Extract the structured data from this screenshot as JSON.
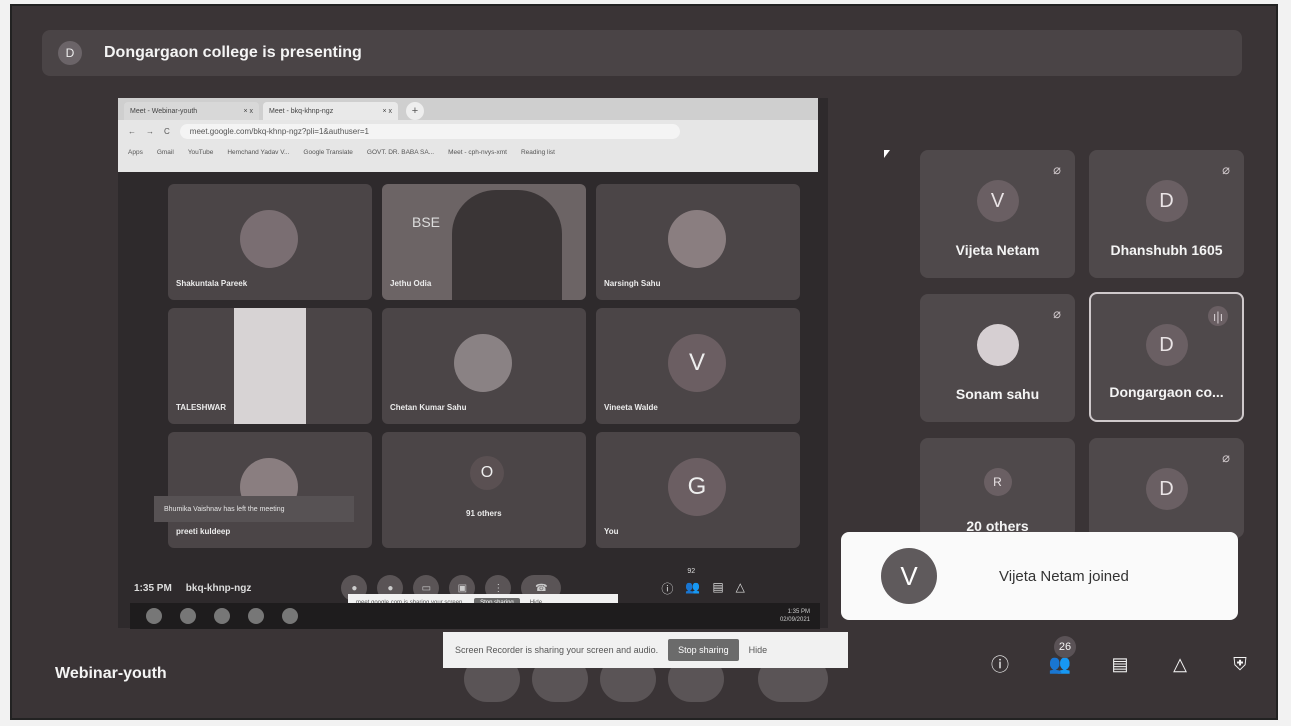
{
  "presenting": {
    "avatar_letter": "D",
    "text": "Dongargaon college is presenting"
  },
  "browser": {
    "tabs": [
      {
        "label": "Meet - Webinar-youth",
        "close": "× x"
      },
      {
        "label": "Meet - bkq-khnp-ngz",
        "close": "× x"
      }
    ],
    "new_tab": "+",
    "url": "meet.google.com/bkq-khnp-ngz?pli=1&authuser=1",
    "bookmarks": [
      "Apps",
      "Gmail",
      "YouTube",
      "Hemchand Yadav V...",
      "Google Translate",
      "GOVT. DR. BABA SA...",
      "Meet - cph-nvys-xmt",
      "Reading list"
    ]
  },
  "shared_meeting": {
    "tiles": [
      {
        "name": "Shakuntala Pareek",
        "type": "photo"
      },
      {
        "name": "Jethu Odia",
        "type": "video",
        "video_text": "BSE"
      },
      {
        "name": "Narsingh Sahu",
        "type": "photo"
      },
      {
        "name": "TALESHWAR",
        "type": "photo"
      },
      {
        "name": "Chetan Kumar Sahu",
        "type": "photo"
      },
      {
        "name": "Vineeta Walde",
        "letter": "V"
      },
      {
        "name": "preeti kuldeep",
        "type": "photo"
      },
      {
        "name": "91 others",
        "letter": "O"
      },
      {
        "name": "You",
        "letter": "G"
      }
    ],
    "left_notice": "Bhumika Vaishnav has left the meeting",
    "time": "1:35 PM",
    "code": "bkq-khnp-ngz",
    "people_badge": "92",
    "inner_share_bar": {
      "text": "meet.google.com is sharing your screen.",
      "stop": "Stop sharing",
      "hide": "Hide"
    },
    "clock": {
      "time": "1:35 PM",
      "date": "02/09/2021"
    }
  },
  "side_tiles": [
    {
      "name": "Vijeta Netam",
      "letter": "V",
      "muted": true
    },
    {
      "name": "Dhanshubh 1605",
      "letter": "D",
      "muted": true
    },
    {
      "name": "Sonam sahu",
      "letter": "",
      "muted": true,
      "photo": true
    },
    {
      "name": "Dongargaon co...",
      "letter": "D",
      "muted": false
    },
    {
      "name": "20 others",
      "letter": "R",
      "muted": false
    },
    {
      "name": "",
      "letter": "D",
      "muted": true
    }
  ],
  "toast": {
    "letter": "V",
    "text": "Vijeta Netam joined"
  },
  "recorder_bar": {
    "text": "Screen Recorder is sharing your screen and audio.",
    "stop": "Stop sharing",
    "hide": "Hide"
  },
  "meeting_title": "Webinar-youth",
  "people_count": "26",
  "colors": {
    "bg": "#3a3436",
    "tile": "#4f494b",
    "toast_bg": "#fafafa"
  }
}
